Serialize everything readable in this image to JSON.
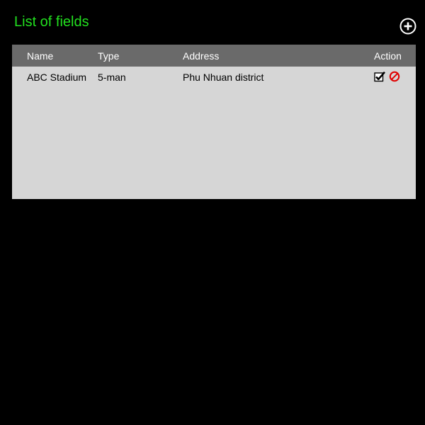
{
  "header": {
    "title": "List of fields",
    "title_color": "#22e01f",
    "add_icon": "plus-circle-icon"
  },
  "table": {
    "columns": {
      "name": "Name",
      "type": "Type",
      "address": "Address",
      "action": "Action"
    },
    "rows": [
      {
        "name": "ABC Stadium",
        "type": "5-man",
        "address": "Phu Nhuan district",
        "actions": [
          "check-icon",
          "ban-icon"
        ]
      }
    ],
    "header_color": "#6a6a6a",
    "body_color": "#d6d6d6",
    "delete_color": "#e00000"
  }
}
